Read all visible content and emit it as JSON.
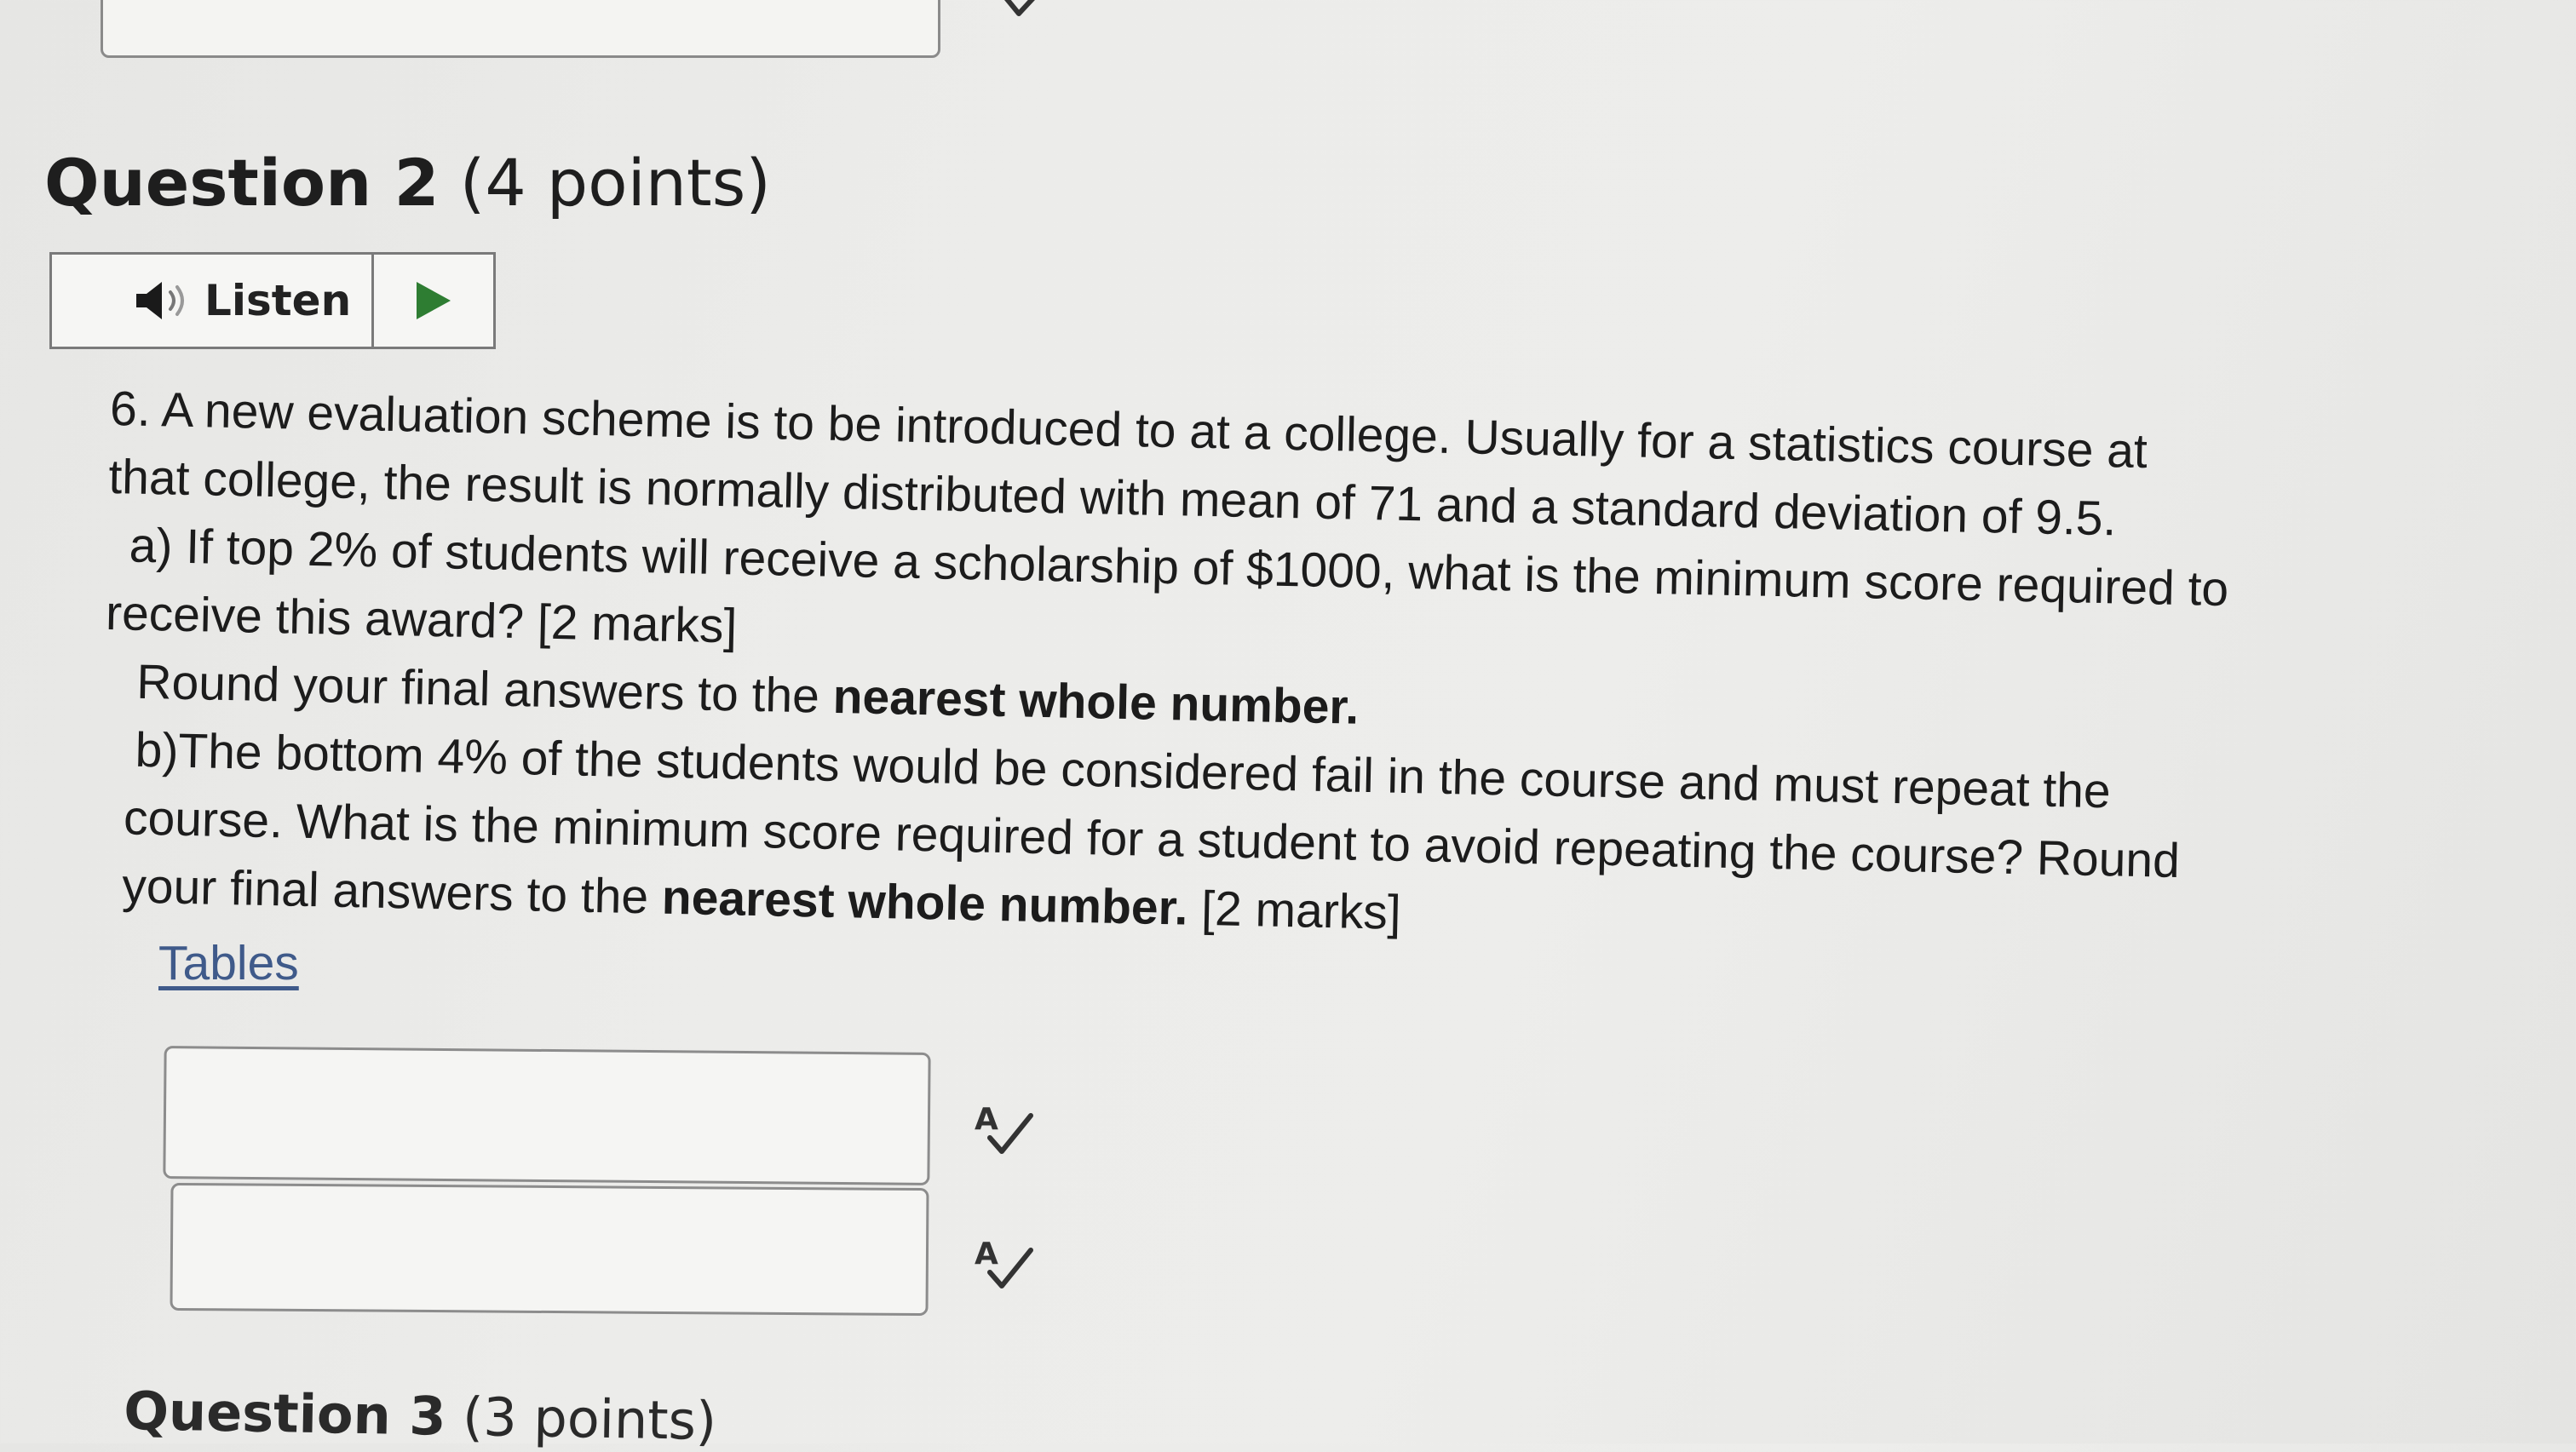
{
  "question": {
    "title": "Question 2",
    "points": "(4 points)"
  },
  "listen": {
    "label": "Listen"
  },
  "body": {
    "line1": "6. A new evaluation scheme is to be introduced to at a college. Usually for a statistics course at",
    "line2": "that college, the result is normally distributed with mean of 71 and a standard deviation of 9.5.",
    "line3": "a) If top 2% of students will receive a scholarship of $1000, what is the minimum score required to",
    "line4": "receive this award? [2 marks]",
    "line5_pre": "Round your final answers to the ",
    "line5_bold": "nearest whole number.",
    "line6": "b)The bottom 4% of the students would be considered fail in the course and must repeat the",
    "line7": "course. What is the minimum score required for a student to avoid repeating the course? Round",
    "line8_pre": "your final answers to the ",
    "line8_bold": "nearest whole number.",
    "line8_post": "  [2 marks]"
  },
  "tables_link": "Tables",
  "answers": [
    {
      "value": "",
      "placeholder": ""
    },
    {
      "value": "",
      "placeholder": ""
    }
  ],
  "icons": {
    "speaker": "speaker-icon",
    "play": "play-icon",
    "spellcheck": "spellcheck-icon"
  },
  "colors": {
    "play_green": "#2e7d32",
    "link": "#3f5a8a"
  },
  "next_question": {
    "title": "Question 3",
    "points": "(3 points)"
  }
}
